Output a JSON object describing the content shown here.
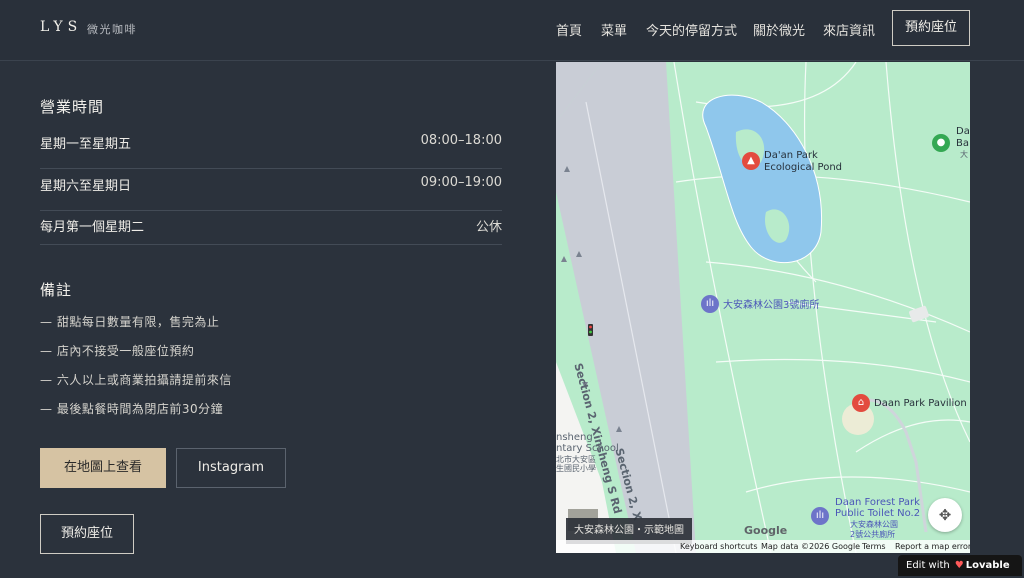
{
  "brand": {
    "logo": "LYS",
    "subtitle": "微光咖啡"
  },
  "nav": {
    "links": [
      "首頁",
      "菜單",
      "今天的停留方式",
      "關於微光",
      "來店資訊"
    ],
    "cta": "預約座位"
  },
  "hours": {
    "title": "營業時間",
    "rows": [
      {
        "day": "星期一至星期五",
        "time": "08:00–18:00"
      },
      {
        "day": "星期六至星期日",
        "time": "09:00–19:00"
      },
      {
        "day": "每月第一個星期二",
        "time": "公休"
      }
    ]
  },
  "notes": {
    "title": "備註",
    "items": [
      "— 甜點每日數量有限，售完為止",
      "— 店內不接受一般座位預約",
      "— 六人以上或商業拍攝請提前來信",
      "— 最後點餐時間為閉店前30分鐘"
    ]
  },
  "buttons": {
    "view_map": "在地圖上查看",
    "instagram": "Instagram",
    "reserve": "預約座位"
  },
  "map": {
    "caption": "大安森林公園・示範地圖",
    "labels": {
      "pond_1": "Da'an Park",
      "pond_2": "Ecological Pond",
      "toilet3": "大安森林公園3號廁所",
      "pavilion": "Daan Park Pavilion",
      "toilet2_1": "Daan Forest Park",
      "toilet2_2": "Public Toilet No.2",
      "toilet2_3": "大安森林公園",
      "toilet2_4": "2號公共廁所",
      "road_1": "Section 2, Xinsheng S Rd",
      "road_2": "Section 2, X",
      "school_1": "nsheng",
      "school_2": "ntary School",
      "school_3": "北市大安區",
      "school_4": "生國民小學",
      "edge_1": "Da",
      "edge_2": "Ba",
      "edge_3": "大"
    },
    "google": "Google",
    "attribution": {
      "shortcuts": "Keyboard shortcuts",
      "data": "Map data ©2026 Google",
      "terms": "Terms",
      "report": "Report a map error"
    }
  },
  "badge": {
    "prefix": "Edit with",
    "brand": "Lovable"
  },
  "colors": {
    "background": "#2b323c",
    "accent": "#d6c3a3",
    "map_park": "#b8ebcb",
    "map_water": "#8fc7ec"
  },
  "icons": [
    "fullscreen-locate-icon",
    "marker-pin-icon",
    "toilet-icon",
    "pavilion-icon"
  ]
}
